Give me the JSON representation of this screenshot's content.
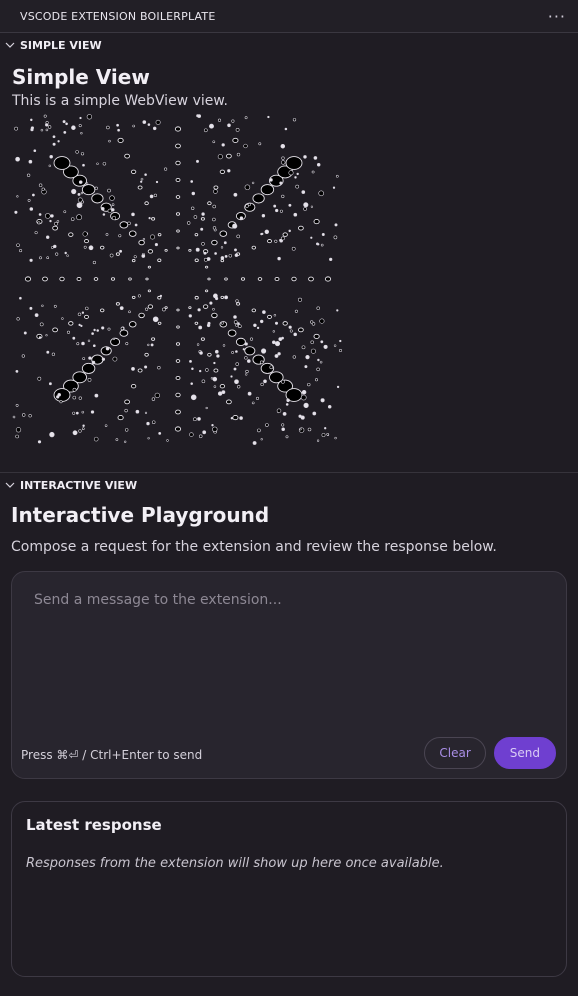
{
  "topbar": {
    "title": "VSCODE EXTENSION BOILERPLATE",
    "more_icon": "ellipsis-icon"
  },
  "simple_view": {
    "section_label": "SIMPLE VIEW",
    "heading": "Simple View",
    "description": "This is a simple WebView view.",
    "image_name": "starfield-art"
  },
  "interactive_view": {
    "section_label": "INTERACTIVE VIEW",
    "heading": "Interactive Playground",
    "description": "Compose a request for the extension and review the response below.",
    "composer": {
      "placeholder": "Send a message to the extension...",
      "value": "",
      "hint": "Press ⌘⏎ / Ctrl+Enter to send",
      "clear_label": "Clear",
      "send_label": "Send"
    },
    "response": {
      "title": "Latest response",
      "empty_text": "Responses from the extension will show up here once available."
    }
  },
  "colors": {
    "background": "#1f1c23",
    "accent": "#6f3fd0",
    "accent_text": "#a98ee6"
  }
}
